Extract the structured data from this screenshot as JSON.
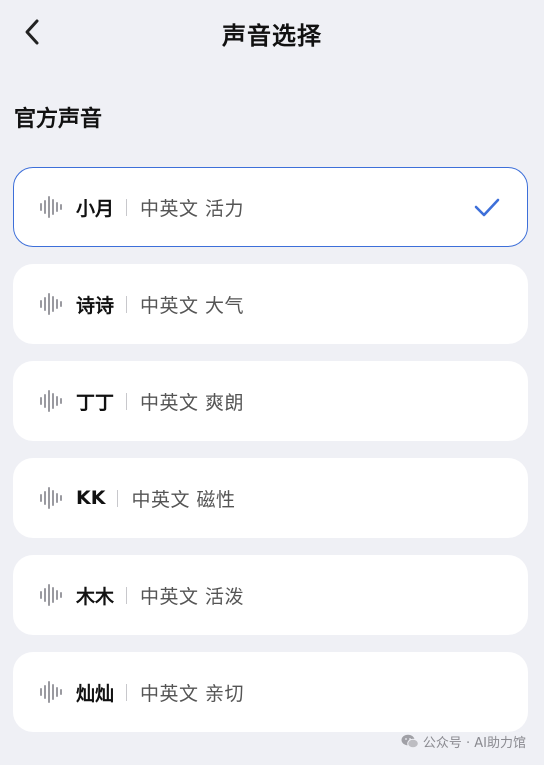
{
  "header": {
    "title": "声音选择",
    "back_icon": "chevron-left-icon"
  },
  "section": {
    "title": "官方声音"
  },
  "voices": [
    {
      "name": "小月",
      "desc": "中英文 活力",
      "selected": true
    },
    {
      "name": "诗诗",
      "desc": "中英文 大气",
      "selected": false
    },
    {
      "name": "丁丁",
      "desc": "中英文 爽朗",
      "selected": false
    },
    {
      "name": "KK",
      "desc": "中英文 磁性",
      "selected": false
    },
    {
      "name": "木木",
      "desc": "中英文 活泼",
      "selected": false
    },
    {
      "name": "灿灿",
      "desc": "中英文 亲切",
      "selected": false
    }
  ],
  "colors": {
    "background": "#eff0f5",
    "card": "#ffffff",
    "accent": "#3d6fd9",
    "wave": "#9a9aa0"
  },
  "watermark": {
    "text": "公众号 · AI助力馆",
    "icon": "wechat-icon"
  }
}
